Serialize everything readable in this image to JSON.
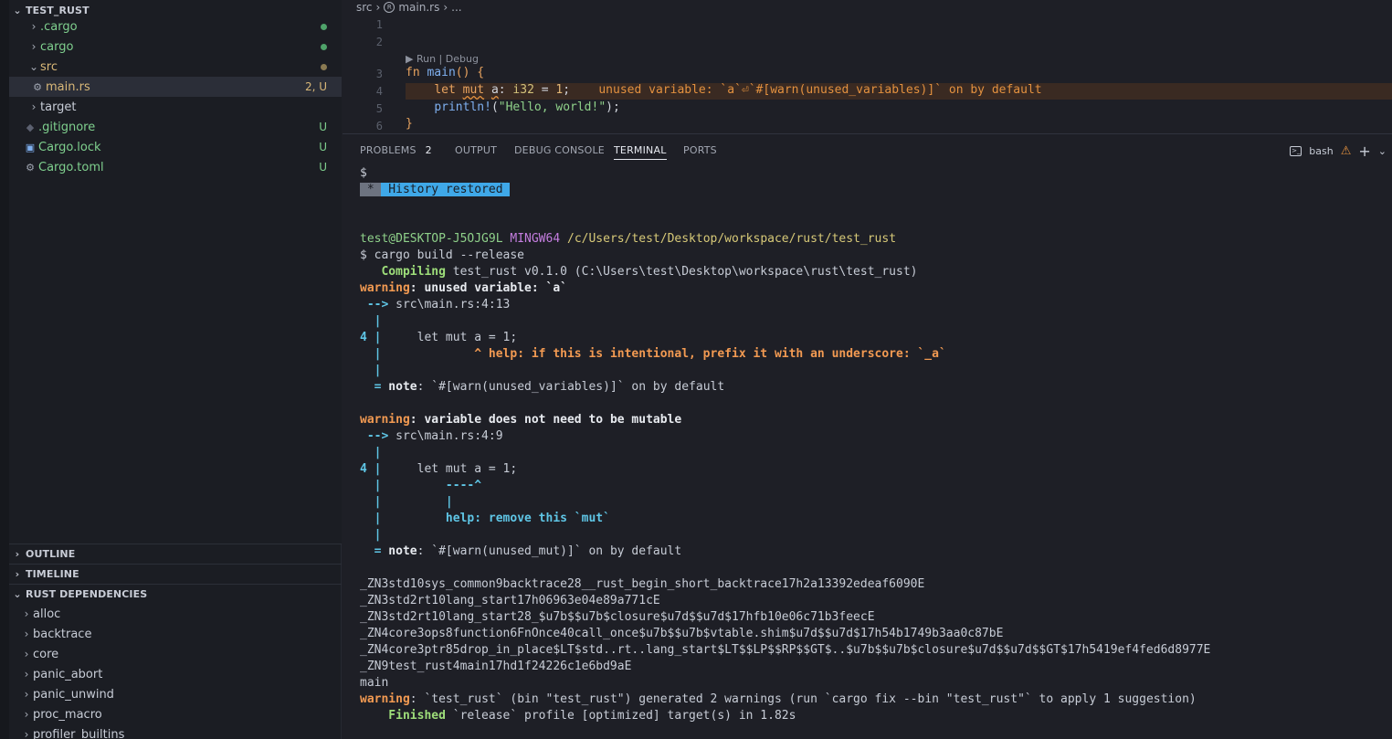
{
  "explorer": {
    "project_title": "TEST_RUST",
    "items": [
      {
        "label": ".cargo",
        "badge": "",
        "status_color": "#4fa36a"
      },
      {
        "label": "cargo",
        "badge": "",
        "status_color": "#4fa36a"
      },
      {
        "label": "src",
        "badge": "",
        "status_color": "#8a7a52"
      },
      {
        "label": "main.rs",
        "badge": "2, U",
        "icon": "rust-icon"
      },
      {
        "label": "target",
        "badge": ""
      },
      {
        "label": ".gitignore",
        "badge": "U",
        "icon": "git-icon"
      },
      {
        "label": "Cargo.lock",
        "badge": "U",
        "icon": "lock-icon"
      },
      {
        "label": "Cargo.toml",
        "badge": "U",
        "icon": "gear-icon"
      }
    ]
  },
  "sections": {
    "outline": "OUTLINE",
    "timeline": "TIMELINE",
    "rust_dependencies": "RUST DEPENDENCIES"
  },
  "dependencies": [
    "alloc",
    "backtrace",
    "core",
    "panic_abort",
    "panic_unwind",
    "proc_macro",
    "profiler_builtins"
  ],
  "editor": {
    "breadcrumb": {
      "folder": "src",
      "file": "main.rs",
      "more": "..."
    },
    "line_numbers": [
      "1",
      "2",
      "3",
      "4",
      "5",
      "6"
    ],
    "codelens": "▶ Run | Debug",
    "code": {
      "l3_kw": "fn",
      "l3_name": "main",
      "l3_rest": "() {",
      "l4_indent": "    ",
      "l4_kw1": "let",
      "l4_kw2": "mut",
      "l4_var": "a",
      "l4_colon": ": ",
      "l4_type": "i32",
      "l4_eq": " = ",
      "l4_num": "1",
      "l4_end": ";",
      "l4_inline_warning": "unused variable: `a`⏎`#[warn(unused_variables)]` on by default",
      "l5_indent": "    ",
      "l5_macro": "println!",
      "l5_open": "(",
      "l5_str": "\"Hello, world!\"",
      "l5_close": ");",
      "l6": "}"
    }
  },
  "panel": {
    "tabs": [
      {
        "label": "PROBLEMS",
        "badge": "2"
      },
      {
        "label": "OUTPUT"
      },
      {
        "label": "DEBUG CONSOLE"
      },
      {
        "label": "TERMINAL",
        "active": true
      },
      {
        "label": "PORTS"
      }
    ],
    "terminal_name": "bash"
  },
  "terminal": {
    "prompt0": "$",
    "history_star": " * ",
    "history_text": " History restored ",
    "user_host": "test@DESKTOP-J5OJG9L",
    "env": "MINGW64",
    "cwd": "/c/Users/test/Desktop/workspace/rust/test_rust",
    "command": "$ cargo build --release",
    "compiling_label": "   Compiling",
    "compiling_rest": " test_rust v0.1.0 (C:\\Users\\test\\Desktop\\workspace\\rust\\test_rust)",
    "w1_label": "warning",
    "w1_msg": ": unused variable: `a`",
    "w1_arrow": " -->",
    "w1_loc": " src\\main.rs:4:13",
    "bar": "  |",
    "w1_line_num": "4 |",
    "w1_code": "     let mut a = 1;",
    "w1_help_pad": "  |",
    "w1_help": "             ^ help: if this is intentional, prefix it with an underscore: `_a`",
    "w1_note_eq": "  =",
    "w1_note_label": " note",
    "w1_note_rest": ": `#[warn(unused_variables)]` on by default",
    "w2_label": "warning",
    "w2_msg": ": variable does not need to be mutable",
    "w2_arrow": " -->",
    "w2_loc": " src\\main.rs:4:9",
    "w2_line_num": "4 |",
    "w2_code": "     let mut a = 1;",
    "w2_marker": "         ----^",
    "w2_pipe": "         |",
    "w2_help": "         help: remove this `mut`",
    "w2_note_eq": "  =",
    "w2_note_label": " note",
    "w2_note_rest": ": `#[warn(unused_mut)]` on by default",
    "symbols": [
      "_ZN3std10sys_common9backtrace28__rust_begin_short_backtrace17h2a13392edeaf6090E",
      "_ZN3std2rt10lang_start17h06963e04e89a771cE",
      "_ZN3std2rt10lang_start28_$u7b$$u7b$closure$u7d$$u7d$17hfb10e06c71b3feecE",
      "_ZN4core3ops8function6FnOnce40call_once$u7b$$u7b$vtable.shim$u7d$$u7d$17h54b1749b3aa0c87bE",
      "_ZN4core3ptr85drop_in_place$LT$std..rt..lang_start$LT$$LP$$RP$$GT$..$u7b$$u7b$closure$u7d$$u7d$$GT$17h5419ef4fed6d8977E",
      "_ZN9test_rust4main17hd1f24226c1e6bd9aE",
      "main"
    ],
    "summary_label": "warning",
    "summary_rest": ": `test_rust` (bin \"test_rust\") generated 2 warnings (run `cargo fix --bin \"test_rust\"` to apply 1 suggestion)",
    "finished_label": "    Finished",
    "finished_rest": " `release` profile [optimized] target(s) in 1.82s"
  }
}
